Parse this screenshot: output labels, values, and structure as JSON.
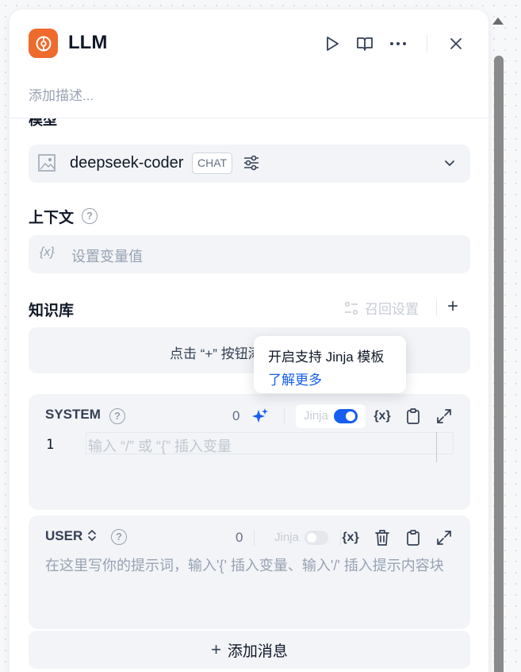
{
  "node": {
    "title": "LLM",
    "description_placeholder": "添加描述...",
    "icon": "llm-brain-icon",
    "accent_color": "#EF6A2D"
  },
  "header_actions": [
    {
      "icon": "run-play-icon"
    },
    {
      "icon": "book-open-icon"
    },
    {
      "icon": "more-horizontal-icon"
    },
    {
      "icon": "close-icon"
    }
  ],
  "model_section": {
    "label": "模型",
    "model_name": "deepseek-coder",
    "mode_badge": "CHAT"
  },
  "context_section": {
    "label": "上下文",
    "help": "?",
    "variable_icon": "{x}",
    "placeholder": "设置变量值"
  },
  "knowledge_section": {
    "label": "知识库",
    "recall_settings": "召回设置",
    "add": "+",
    "empty_text": "点击 “+” 按钮添加知识库"
  },
  "tooltip": {
    "line1": "开启支持 Jinja 模板",
    "link": "了解更多"
  },
  "system_prompt": {
    "role": "SYSTEM",
    "help": "?",
    "count": "0",
    "jinja_label": "Jinja",
    "jinja_enabled": true,
    "variable_icon": "{x}",
    "line_number": "1",
    "placeholder": "输入 “/” 或 “{” 插入变量"
  },
  "user_prompt": {
    "role": "USER",
    "help": "?",
    "count": "0",
    "jinja_label": "Jinja",
    "jinja_enabled": false,
    "variable_icon": "{x}",
    "placeholder": "在这里写你的提示词，输入'{' 插入变量、输入'/' 插入提示内容块"
  },
  "add_message": {
    "plus": "+",
    "label": "添加消息"
  }
}
